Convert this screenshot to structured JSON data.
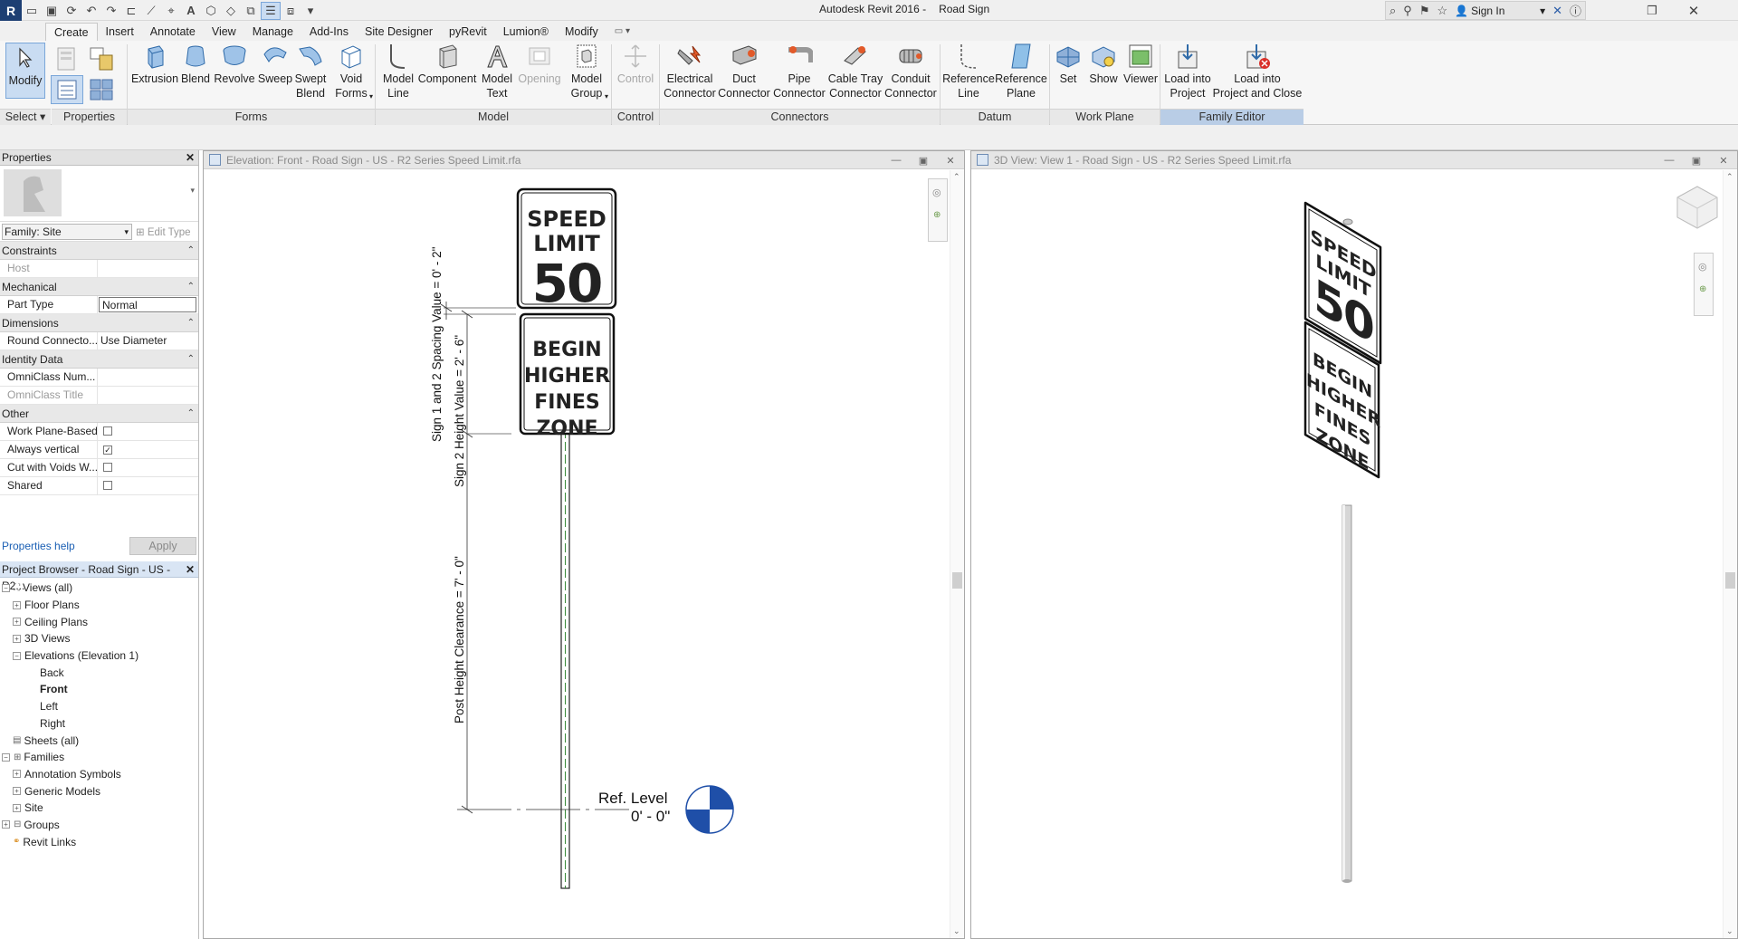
{
  "app": {
    "title": "Autodesk Revit 2016 -",
    "doc": "Road Sign",
    "sign_in": "Sign In"
  },
  "tabs": [
    "Create",
    "Insert",
    "Annotate",
    "View",
    "Manage",
    "Add-Ins",
    "Site Designer",
    "pyRevit",
    "Lumion®",
    "Modify"
  ],
  "ribbon": {
    "modify": "Modify",
    "select": "Select ▾",
    "panels": {
      "properties": "Properties",
      "forms": "Forms",
      "model": "Model",
      "control": "Control",
      "connectors": "Connectors",
      "datum": "Datum",
      "work_plane": "Work Plane",
      "family_editor": "Family Editor"
    },
    "buttons": {
      "extrusion": "Extrusion",
      "blend": "Blend",
      "revolve": "Revolve",
      "sweep": "Sweep",
      "swept_blend": "Swept\nBlend",
      "void_forms": "Void\nForms",
      "model_line": "Model\nLine",
      "component": "Component",
      "model_text": "Model\nText",
      "opening": "Opening",
      "model_group": "Model\nGroup",
      "control": "Control",
      "electrical_connector": "Electrical\nConnector",
      "duct_connector": "Duct\nConnector",
      "pipe_connector": "Pipe\nConnector",
      "cable_tray_connector": "Cable Tray\nConnector",
      "conduit_connector": "Conduit\nConnector",
      "reference_line": "Reference\nLine",
      "reference_plane": "Reference\nPlane",
      "set": "Set",
      "show": "Show",
      "viewer": "Viewer",
      "load_into_project": "Load into\nProject",
      "load_into_project_close": "Load into\nProject and Close"
    }
  },
  "properties": {
    "header": "Properties",
    "family": "Family: Site",
    "edit_type": "Edit Type",
    "groups": {
      "constraints": "Constraints",
      "mechanical": "Mechanical",
      "dimensions": "Dimensions",
      "identity": "Identity Data",
      "other": "Other"
    },
    "rows": {
      "host": "Host",
      "part_type": "Part Type",
      "part_type_val": "Normal",
      "round_conn": "Round Connecto...",
      "round_conn_val": "Use Diameter",
      "omni_num": "OmniClass Num...",
      "omni_title": "OmniClass Title",
      "wpb": "Work Plane-Based",
      "always_vertical": "Always vertical",
      "cut_voids": "Cut with Voids W...",
      "shared": "Shared"
    },
    "help": "Properties help",
    "apply": "Apply"
  },
  "browser": {
    "header": "Project Browser - Road Sign - US - R2...",
    "items": {
      "views": "Views (all)",
      "floor": "Floor Plans",
      "ceiling": "Ceiling Plans",
      "views3d": "3D Views",
      "elevations": "Elevations (Elevation 1)",
      "back": "Back",
      "front": "Front",
      "left": "Left",
      "right": "Right",
      "sheets": "Sheets (all)",
      "families": "Families",
      "annotation": "Annotation Symbols",
      "generic": "Generic Models",
      "site": "Site",
      "groups": "Groups",
      "links": "Revit Links"
    }
  },
  "views": {
    "elevation_title": "Elevation: Front - Road Sign - US - R2 Series Speed Limit.rfa",
    "view3d_title": "3D View: View 1 - Road Sign - US - R2 Series Speed Limit.rfa"
  },
  "sign": {
    "line1": "SPEED",
    "line2": "LIMIT",
    "number": "50",
    "b1": "BEGIN",
    "b2": "HIGHER",
    "b3": "FINES",
    "b4": "ZONE"
  },
  "dims": {
    "spacing": "Sign 1 and 2 Spacing Value = 0' - 2\"",
    "height": "Sign 2 Height Value = 2' - 6\"",
    "clearance": "Post Height Clearance = 7' - 0\"",
    "ref_level": "Ref. Level",
    "ref_value": "0' - 0\""
  }
}
